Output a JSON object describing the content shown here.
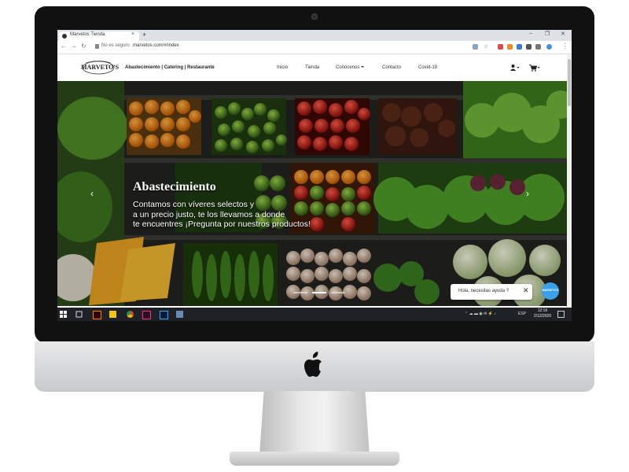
{
  "browser": {
    "tab_title": "Marvetos Tienda",
    "tab_close": "×",
    "new_tab": "+",
    "url_security": "No es seguro",
    "url": "marvetos.com/#/index",
    "window_minimize": "–",
    "window_maximize": "❐",
    "window_close": "✕"
  },
  "site": {
    "logo_text": "MARVETO'S",
    "tagline": "Abastecimiento | Catering | Restaurante",
    "menu": [
      "Inicio",
      "Tienda",
      "Conócenos",
      "Contacto",
      "Covid-19"
    ]
  },
  "hero": {
    "title": "Abastecimiento",
    "text_lines": [
      "Contamos con víveres selectos y",
      "a un precio justo, te los llevamos a donde",
      "te encuentres ¡Pregunta por nuestros productos!"
    ],
    "prev_arrow": "‹",
    "next_arrow": "›",
    "slides": 3,
    "active_slide": 2
  },
  "chat": {
    "message": "Hola, necesitas ayuda ?",
    "close": "✕",
    "button_label": "MARVETO'S"
  },
  "taskbar": {
    "language": "ESP",
    "time": "12:16",
    "date": "2/12/2020"
  },
  "colors": {
    "chat_button": "#3aa0e8",
    "taskbar": "#1e2126",
    "tab_bar": "#dee1e6"
  }
}
